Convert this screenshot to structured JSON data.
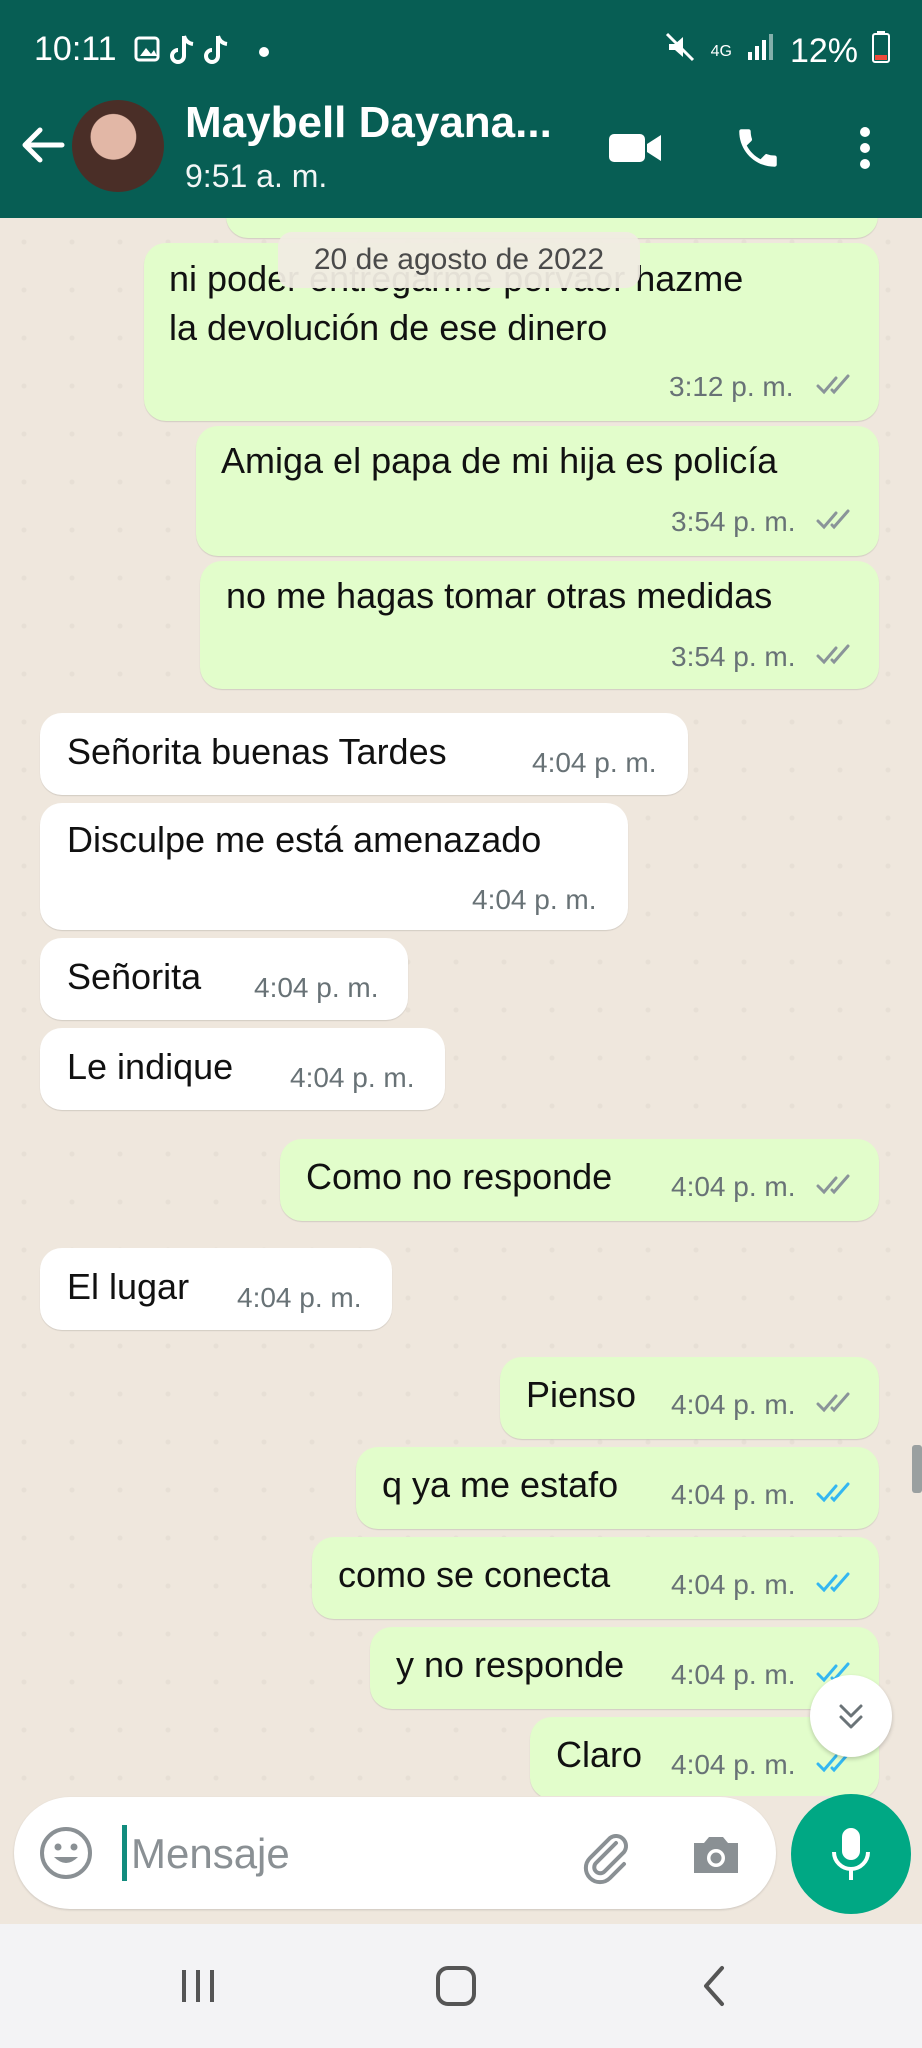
{
  "status_bar": {
    "time": "10:11",
    "battery": "12%",
    "network": "4G"
  },
  "header": {
    "contact_name": "Maybell Dayana...",
    "last_seen": "9:51 a. m."
  },
  "date_chip": "20 de agosto de 2022",
  "messages": [
    {
      "dir": "out",
      "lines": [
        "ni poder entregarme porvaor hazme",
        "la devolución de ese dinero"
      ],
      "time": "3:12 p. m.",
      "status": "delivered"
    },
    {
      "dir": "out",
      "text": "Amiga el papa de mi hija es policía",
      "time": "3:54 p. m.",
      "status": "delivered"
    },
    {
      "dir": "out",
      "text": "no me hagas tomar otras medidas",
      "time": "3:54 p. m.",
      "status": "delivered"
    },
    {
      "dir": "in",
      "text": "Señorita buenas Tardes",
      "time": "4:04 p. m."
    },
    {
      "dir": "in",
      "text": "Disculpe me está amenazado",
      "time": "4:04 p. m."
    },
    {
      "dir": "in",
      "text": "Señorita",
      "time": "4:04 p. m."
    },
    {
      "dir": "in",
      "text": "Le indique",
      "time": "4:04 p. m."
    },
    {
      "dir": "out",
      "text": "Como no responde",
      "time": "4:04 p. m.",
      "status": "delivered"
    },
    {
      "dir": "in",
      "text": "El lugar",
      "time": "4:04 p. m."
    },
    {
      "dir": "out",
      "text": "Pienso",
      "time": "4:04 p. m.",
      "status": "delivered"
    },
    {
      "dir": "out",
      "text": "q ya me estafo",
      "time": "4:04 p. m.",
      "status": "read"
    },
    {
      "dir": "out",
      "text": "como se conecta",
      "time": "4:04 p. m.",
      "status": "read"
    },
    {
      "dir": "out",
      "text": "y no responde",
      "time": "4:04 p. m.",
      "status": "read"
    },
    {
      "dir": "out",
      "text": "Claro",
      "time": "4:04 p. m.",
      "status": "read"
    }
  ],
  "input": {
    "placeholder": "Mensaje"
  },
  "icons": {
    "back": "arrow-left-icon",
    "video": "video-call-icon",
    "call": "phone-icon",
    "menu": "more-vert-icon",
    "emoji": "emoji-icon",
    "attach": "paperclip-icon",
    "camera": "camera-icon",
    "mic": "microphone-icon",
    "scroll_down": "double-chevron-down-icon"
  },
  "colors": {
    "header": "#075e54",
    "outgoing": "#e2fdcb",
    "incoming": "#ffffff",
    "read_tick": "#34b7f1",
    "delivered_tick": "#8a9499",
    "mic": "#00a884"
  }
}
